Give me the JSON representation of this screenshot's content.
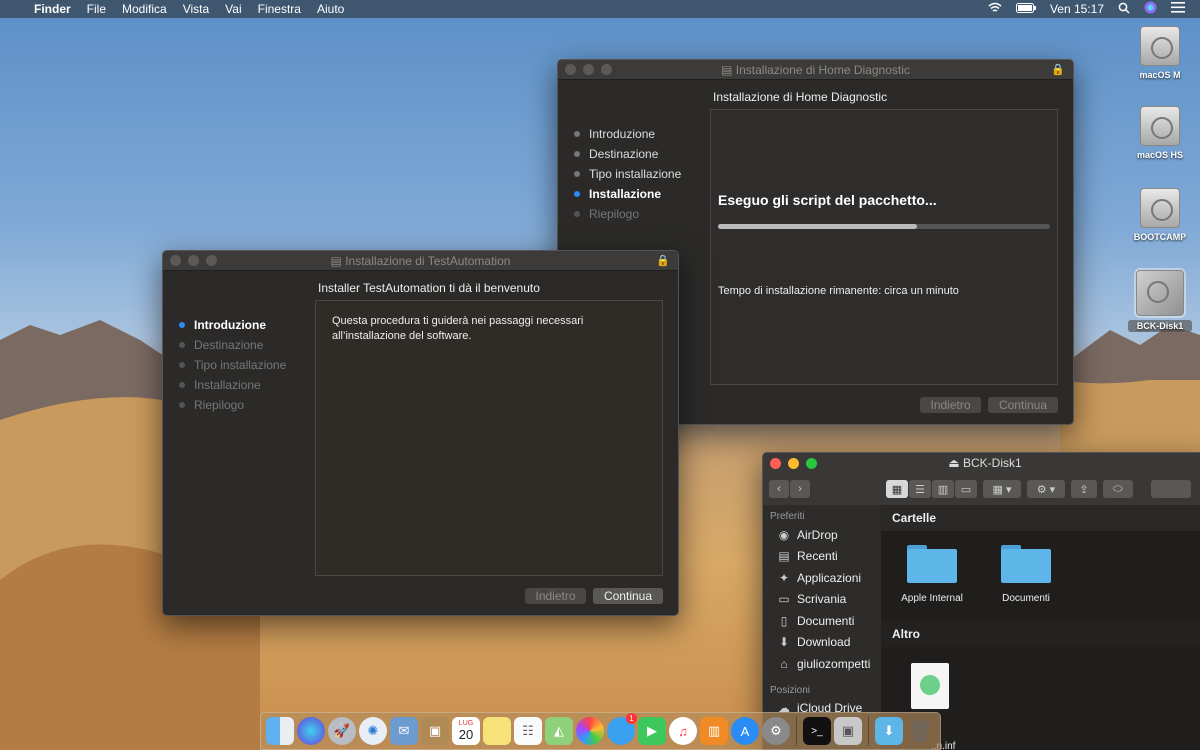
{
  "menubar": {
    "app": "Finder",
    "menus": [
      "File",
      "Modifica",
      "Vista",
      "Vai",
      "Finestra",
      "Aiuto"
    ],
    "clock": "Ven 15:17",
    "icons": [
      "wifi-icon",
      "battery-icon",
      "search-icon",
      "siri-icon",
      "menu-list-icon"
    ]
  },
  "installer_home": {
    "title": "Installazione di Home Diagnostic",
    "heading": "Installazione di Home Diagnostic",
    "steps": [
      "Introduzione",
      "Destinazione",
      "Tipo installazione",
      "Installazione",
      "Riepilogo"
    ],
    "active_step": "Installazione",
    "status": "Eseguo gli script del pacchetto...",
    "progress": 0.6,
    "time_remaining": "Tempo di installazione rimanente: circa un minuto",
    "back_label": "Indietro",
    "continue_label": "Continua"
  },
  "installer_test": {
    "title": "Installazione di TestAutomation",
    "heading": "Installer TestAutomation ti dà il benvenuto",
    "steps": [
      "Introduzione",
      "Destinazione",
      "Tipo installazione",
      "Installazione",
      "Riepilogo"
    ],
    "active_step": "Introduzione",
    "body_line1": "Questa procedura ti guiderà nei passaggi necessari",
    "body_line2": "all’installazione del software.",
    "back_label": "Indietro",
    "continue_label": "Continua"
  },
  "desktop_icons": [
    "macOS M",
    "macOS HS",
    "BOOTCAMP",
    "BCK-Disk1"
  ],
  "finder": {
    "title": "BCK-Disk1",
    "sidebar_favorites_header": "Preferiti",
    "favorites": [
      "AirDrop",
      "Recenti",
      "Applicazioni",
      "Scrivania",
      "Documenti",
      "Download",
      "giuliozompetti"
    ],
    "sidebar_locations_header": "Posizioni",
    "locations": [
      "iCloud Drive"
    ],
    "section_folders": "Cartelle",
    "folders": [
      "Apple Internal",
      "Documenti"
    ],
    "section_other": "Altro",
    "other_file_partial": "..n.inf"
  },
  "dock": {
    "calendar_day": "20",
    "calendar_month": "LUG",
    "badge": "1"
  }
}
